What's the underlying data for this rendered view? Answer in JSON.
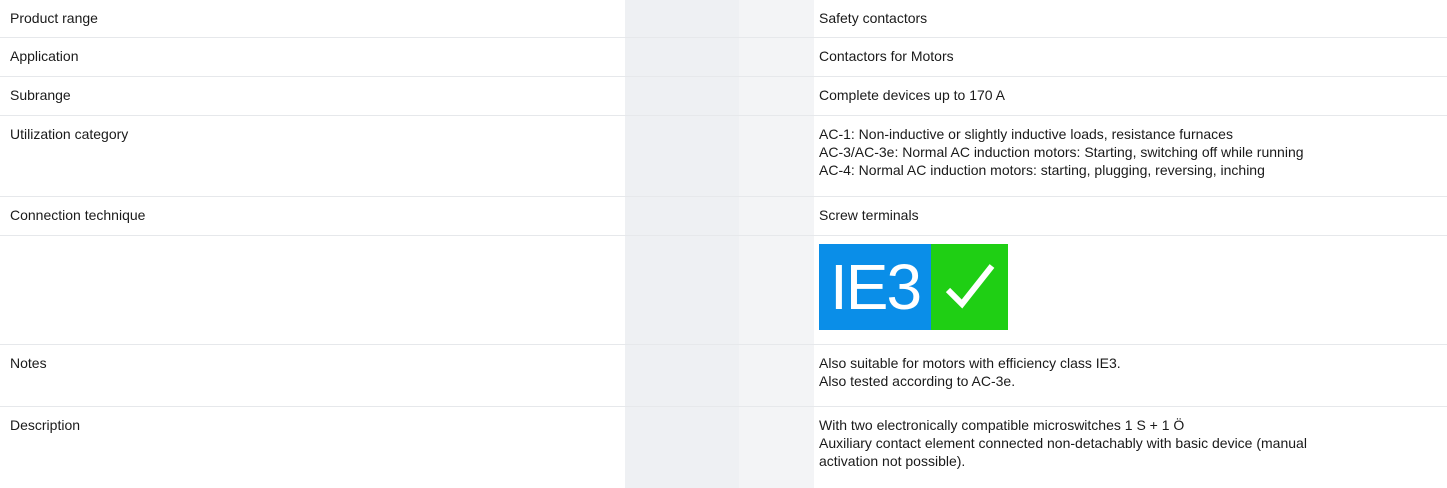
{
  "rows": [
    {
      "label": "Product range",
      "values": [
        "Safety contactors"
      ]
    },
    {
      "label": "Application",
      "values": [
        "Contactors for Motors"
      ]
    },
    {
      "label": "Subrange",
      "values": [
        "Complete devices up to 170 A"
      ]
    },
    {
      "label": "Utilization category",
      "values": [
        "AC-1: Non-inductive or slightly inductive loads, resistance furnaces",
        "AC-3/AC-3e: Normal AC induction motors: Starting, switching off while running",
        "AC-4: Normal AC induction motors: starting, plugging, reversing, inching"
      ]
    },
    {
      "label": "Connection technique",
      "values": [
        "Screw terminals"
      ]
    },
    {
      "label": "",
      "badge": {
        "text": "IE3",
        "icon": "checkmark-icon",
        "text_bg": "#0a8ee8",
        "icon_bg": "#1fcf14"
      }
    },
    {
      "label": "Notes",
      "values": [
        "Also suitable for motors with efficiency class IE3.",
        "Also tested according to AC-3e."
      ]
    },
    {
      "label": "Description",
      "values": [
        "With two electronically compatible microswitches 1 S + 1 Ö",
        "Auxiliary contact element connected non-detachably with basic device (manual",
        "activation not possible)."
      ]
    }
  ]
}
